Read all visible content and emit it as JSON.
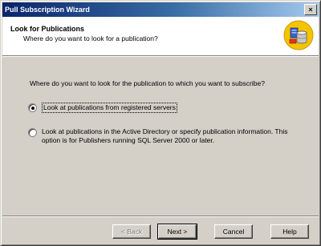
{
  "window": {
    "title": "Pull Subscription Wizard",
    "close_glyph": "×"
  },
  "header": {
    "title": "Look for Publications",
    "subtitle": "Where do you want to look for a publication?",
    "icon": "database-wizard-icon"
  },
  "main": {
    "question": "Where do you want to look for the publication to which you want to subscribe?",
    "options": [
      {
        "label": "Look at publications from registered servers",
        "selected": true
      },
      {
        "label": "Look at publications in the Active Directory or specify publication information. This option is for Publishers running SQL Server 2000 or later.",
        "selected": false
      }
    ]
  },
  "buttons": {
    "back": "< Back",
    "next": "Next >",
    "cancel": "Cancel",
    "help": "Help"
  },
  "colors": {
    "titlebar_start": "#0a246a",
    "titlebar_end": "#a6caf0",
    "face": "#d4d0c8",
    "icon_accent": "#f5c400"
  }
}
